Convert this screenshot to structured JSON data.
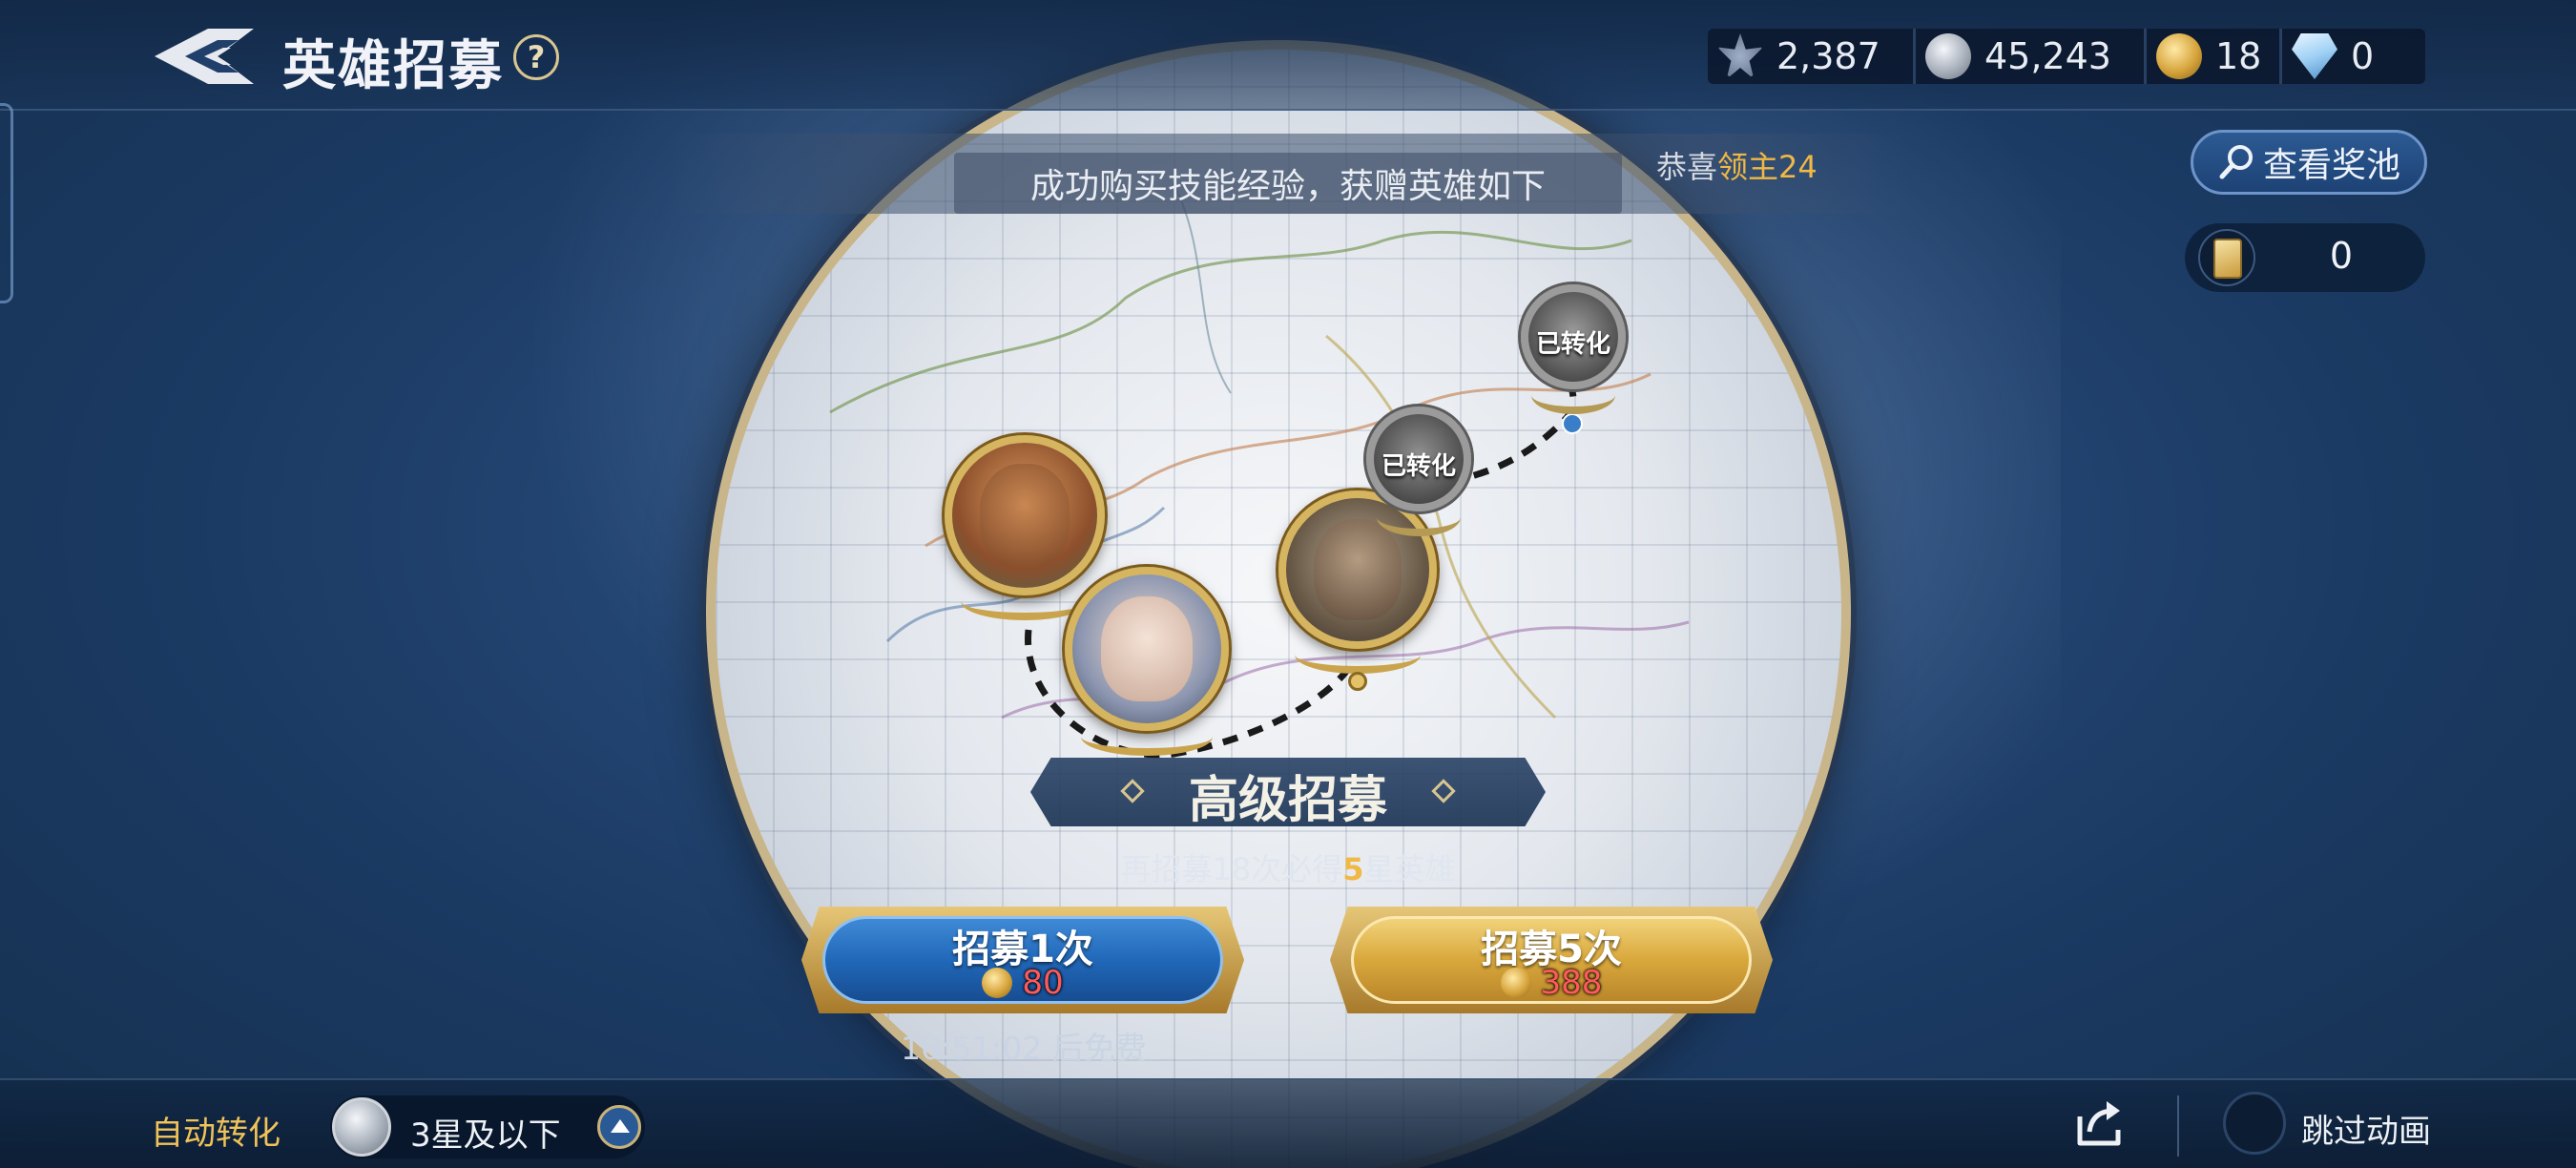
{
  "header": {
    "title": "英雄招募",
    "help_label": "?"
  },
  "currencies": [
    {
      "icon": "might-icon",
      "value": "2,387"
    },
    {
      "icon": "silver-coin-icon",
      "value": "45,243"
    },
    {
      "icon": "gold-coin-icon",
      "value": "18"
    },
    {
      "icon": "diamond-icon",
      "value": "0"
    }
  ],
  "banner": {
    "message": "成功购买技能经验，获赠英雄如下",
    "congrats_prefix": "恭喜",
    "player_name": "领主24"
  },
  "pool_button": {
    "label": "查看奖池"
  },
  "ticket": {
    "count": "0"
  },
  "heroes": [
    {
      "status": ""
    },
    {
      "status": ""
    },
    {
      "status": ""
    },
    {
      "status": "已转化"
    },
    {
      "status": "已转化"
    }
  ],
  "recruit": {
    "title": "高级招募",
    "guarantee_prefix": "再招募18次必得",
    "guarantee_star": "5",
    "guarantee_suffix": "星英雄",
    "single": {
      "label": "招募1次",
      "cost": "80"
    },
    "multi": {
      "label": "招募5次",
      "cost": "388"
    },
    "free_timer": "10:51:02 后免费"
  },
  "footer": {
    "auto_convert_label": "自动转化",
    "filter_value": "3星及以下",
    "skip_label": "跳过动画"
  },
  "colors": {
    "accent_gold": "#f0b844",
    "cost_red": "#ff5a5a",
    "frame_gold": "#d6b560"
  }
}
